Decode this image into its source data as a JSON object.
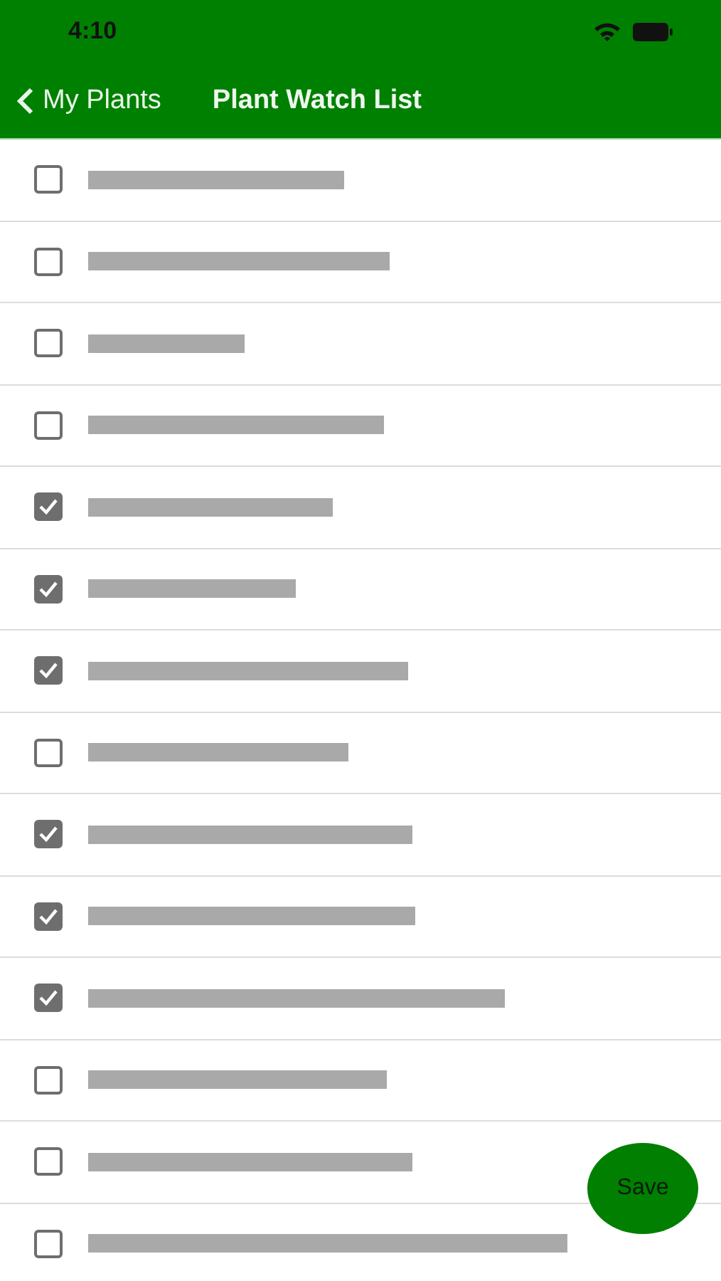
{
  "status_bar": {
    "time": "4:10"
  },
  "nav": {
    "back_label": "My Plants",
    "title": "Plant Watch List"
  },
  "plants": [
    {
      "checked": false
    },
    {
      "checked": false
    },
    {
      "checked": false
    },
    {
      "checked": false
    },
    {
      "checked": true
    },
    {
      "checked": true
    },
    {
      "checked": true
    },
    {
      "checked": false
    },
    {
      "checked": true
    },
    {
      "checked": true
    },
    {
      "checked": true
    },
    {
      "checked": false
    },
    {
      "checked": false
    },
    {
      "checked": false
    }
  ],
  "save_button": {
    "label": "Save"
  }
}
